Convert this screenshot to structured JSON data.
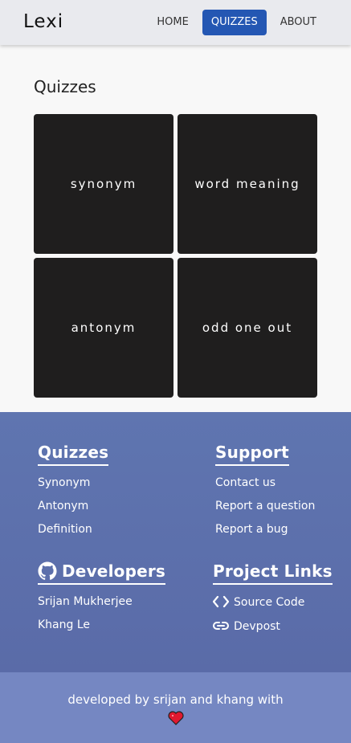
{
  "nav": {
    "brand": "Lexi",
    "links": [
      "HOME",
      "QUIZZES",
      "ABOUT"
    ],
    "active": "QUIZZES",
    "accent": "#2457b3"
  },
  "main": {
    "title": "Quizzes",
    "cards": [
      "synonym",
      "word meaning",
      "antonym",
      "odd one out"
    ]
  },
  "footer": {
    "quizzes": {
      "heading": "Quizzes",
      "links": [
        "Synonym",
        "Antonym",
        "Definition"
      ]
    },
    "support": {
      "heading": "Support",
      "links": [
        "Contact us",
        "Report a question",
        "Report a bug"
      ]
    },
    "developers": {
      "heading": "Developers",
      "icon": "github-icon",
      "links": [
        "Srijan Mukherjee",
        "Khang Le"
      ]
    },
    "project": {
      "heading": "Project Links",
      "links": [
        {
          "label": "Source Code",
          "icon": "code-icon"
        },
        {
          "label": "Devpost",
          "icon": "link-icon"
        }
      ]
    },
    "credit": "developed by srijan and khang with",
    "heart_icon": "heart-icon",
    "background": "#5f75b0",
    "bottom_background": "#7587c2"
  }
}
